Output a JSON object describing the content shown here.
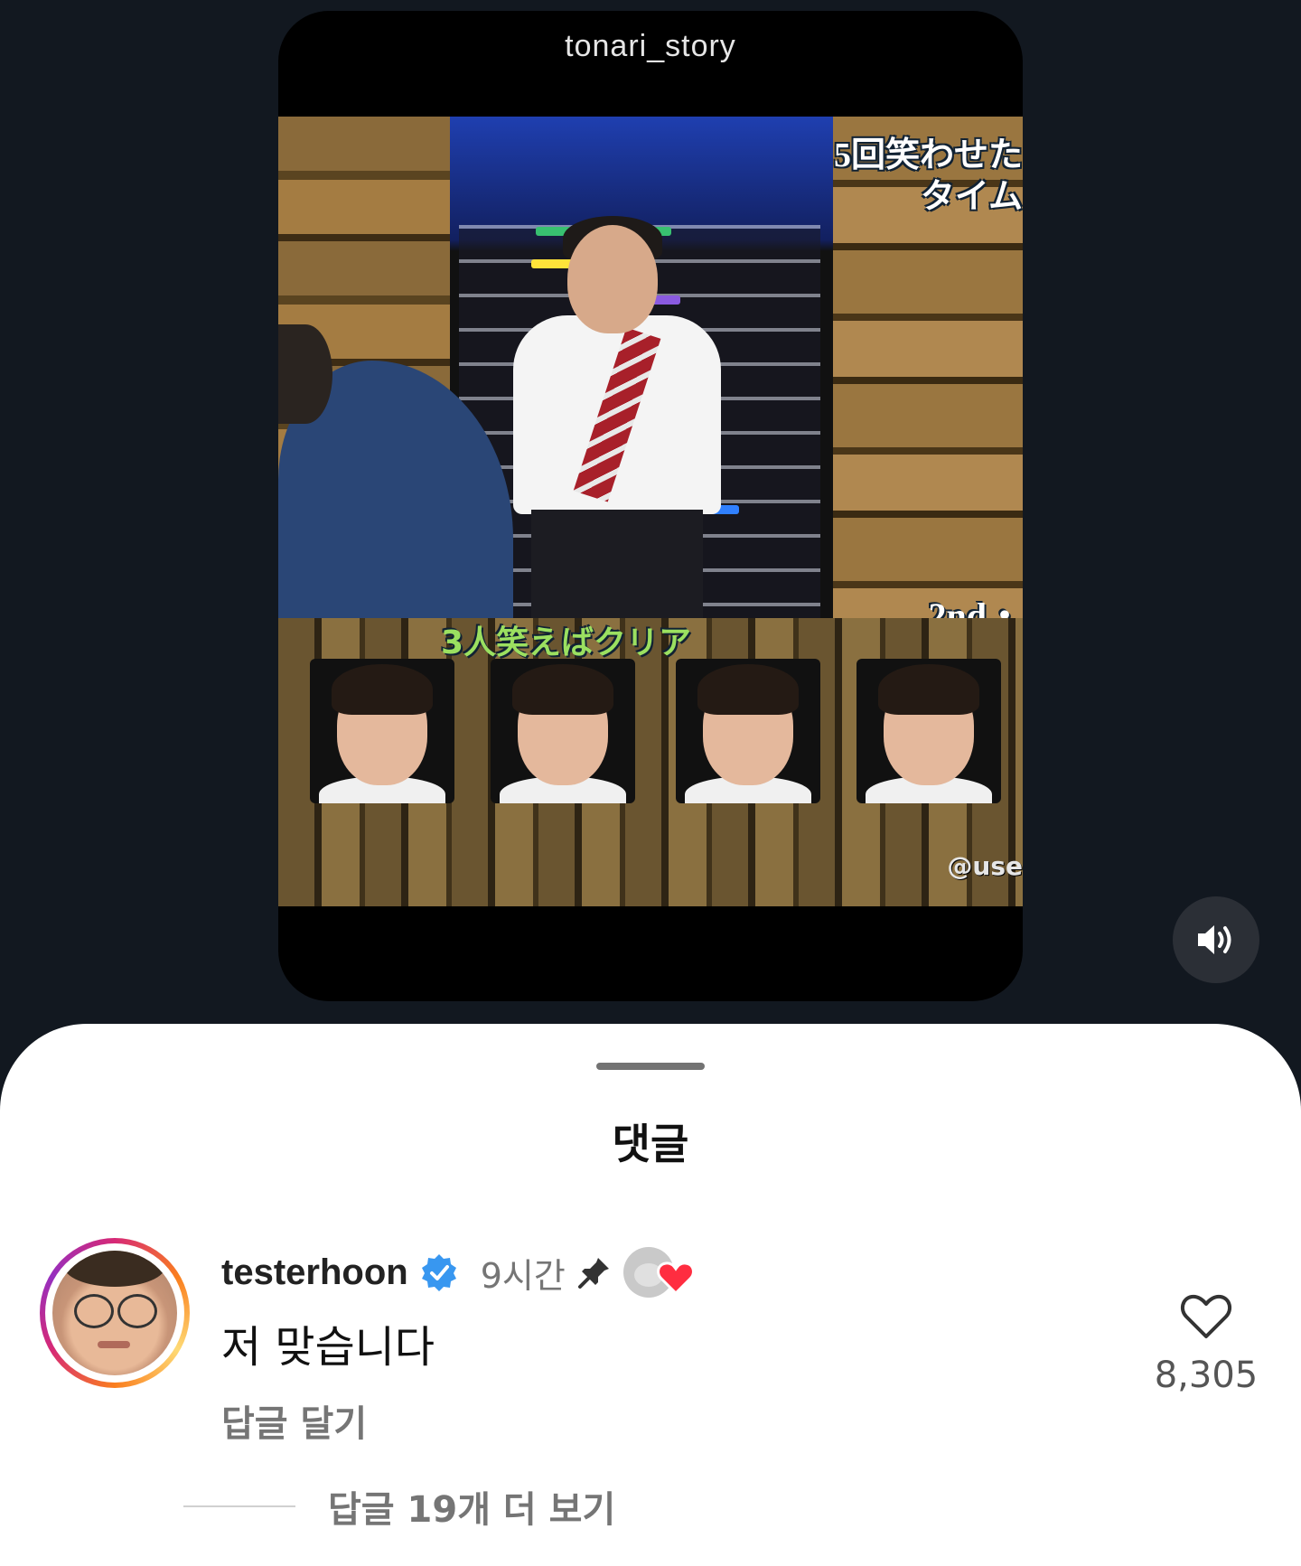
{
  "reel": {
    "username": "tonari_story",
    "caption_top": "5回笑わせた\nタイム",
    "badge": "2nd・",
    "panel_caption": "3人笑えばクリア",
    "watermark": "@use"
  },
  "controls": {
    "sound_icon": "speaker-on-icon"
  },
  "sheet": {
    "title": "댓글"
  },
  "comment": {
    "username": "testerhoon",
    "verified_icon": "verified-badge-icon",
    "time": "9시간",
    "pinned_icon": "pin-icon",
    "liked_by_creator_icon": "creator-liked-heart-icon",
    "text": "저 맞습니다",
    "reply_label": "답글 달기",
    "like_count": "8,305",
    "more_replies": "답글 19개 더 보기"
  },
  "colors": {
    "background": "#121820",
    "verified": "#3897f0",
    "heart_red": "#ff2d40",
    "secondary_text": "#757575"
  }
}
